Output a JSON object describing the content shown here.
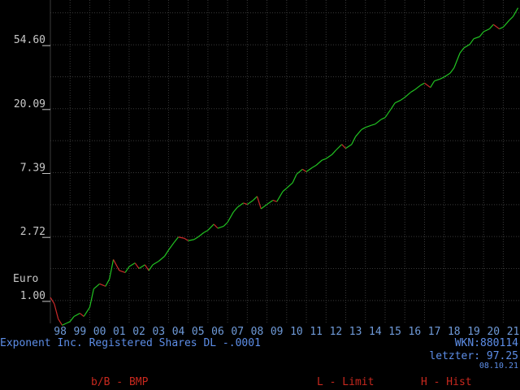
{
  "colors": {
    "background": "#000000",
    "grid": "#3a3a3a",
    "price_line": "#22c322",
    "decline_ticks": "#cc2a2a",
    "axis_text": "#c8c8c8",
    "year_labels": "#6f9ad8",
    "info_text": "#5d8ee8",
    "hotkey_text": "#c8281e"
  },
  "footer": {
    "security_name": "Exponent Inc. Registered Shares DL -.0001",
    "wkn": "WKN:880114",
    "last_price": "letzter: 97.25",
    "last_date": "08.10.21",
    "hotkeys": [
      "b/B - BMP",
      "L - Limit",
      "H - Hist"
    ]
  },
  "chart_data": {
    "type": "line",
    "title": "",
    "xlabel": "",
    "ylabel": "Euro",
    "y_scale": "log",
    "grid": true,
    "x_tick_labels": [
      "98",
      "99",
      "00",
      "01",
      "02",
      "03",
      "04",
      "05",
      "06",
      "07",
      "08",
      "09",
      "10",
      "11",
      "12",
      "13",
      "14",
      "15",
      "16",
      "17",
      "18",
      "19",
      "20",
      "21"
    ],
    "y_tick_labels": [
      "1.00",
      "2.72",
      "7.39",
      "20.09",
      "54.60"
    ],
    "y_tick_values": [
      1.0,
      2.72,
      7.39,
      20.09,
      54.6
    ],
    "ylim": [
      0.7,
      110
    ],
    "xlim": [
      1998.0,
      2021.85
    ],
    "series": [
      {
        "x": [
          1998.0,
          1998.2,
          1998.4,
          1998.6,
          1998.8,
          1999.0,
          1999.2,
          1999.5,
          1999.7,
          2000.0,
          2000.2,
          2000.5,
          2000.8,
          2001.0,
          2001.2,
          2001.5,
          2001.8,
          2002.0,
          2002.3,
          2002.5,
          2002.8,
          2003.0,
          2003.2,
          2003.5,
          2003.8,
          2004.0,
          2004.3,
          2004.5,
          2004.8,
          2005.0,
          2005.3,
          2005.5,
          2005.8,
          2006.0,
          2006.3,
          2006.5,
          2006.8,
          2007.0,
          2007.3,
          2007.5,
          2007.8,
          2008.0,
          2008.3,
          2008.5,
          2008.7,
          2009.0,
          2009.3,
          2009.5,
          2009.8,
          2010.0,
          2010.3,
          2010.5,
          2010.8,
          2011.0,
          2011.3,
          2011.5,
          2011.8,
          2012.0,
          2012.3,
          2012.5,
          2012.8,
          2013.0,
          2013.3,
          2013.5,
          2013.8,
          2014.0,
          2014.3,
          2014.5,
          2014.8,
          2015.0,
          2015.3,
          2015.5,
          2015.8,
          2016.0,
          2016.3,
          2016.5,
          2016.8,
          2017.0,
          2017.3,
          2017.5,
          2017.8,
          2018.0,
          2018.3,
          2018.5,
          2018.8,
          2019.0,
          2019.3,
          2019.5,
          2019.8,
          2020.0,
          2020.3,
          2020.5,
          2020.8,
          2021.0,
          2021.3,
          2021.5,
          2021.75
        ],
        "y": [
          1.05,
          0.95,
          0.75,
          0.68,
          0.7,
          0.72,
          0.78,
          0.82,
          0.78,
          0.9,
          1.2,
          1.3,
          1.25,
          1.4,
          1.9,
          1.6,
          1.55,
          1.7,
          1.8,
          1.65,
          1.75,
          1.6,
          1.75,
          1.85,
          2.0,
          2.2,
          2.5,
          2.7,
          2.65,
          2.55,
          2.6,
          2.7,
          2.9,
          3.0,
          3.3,
          3.1,
          3.2,
          3.4,
          4.0,
          4.3,
          4.6,
          4.5,
          4.8,
          5.1,
          4.2,
          4.5,
          4.8,
          4.7,
          5.5,
          5.8,
          6.3,
          7.2,
          7.8,
          7.5,
          8.0,
          8.3,
          9.0,
          9.2,
          9.8,
          10.5,
          11.5,
          10.8,
          11.5,
          13.0,
          14.5,
          15.0,
          15.5,
          15.8,
          17.0,
          17.5,
          20.0,
          22.0,
          23.0,
          24.0,
          26.0,
          27.0,
          29.0,
          30.0,
          28.0,
          31.0,
          32.0,
          33.0,
          35.0,
          38.0,
          48.0,
          52.0,
          55.0,
          60.0,
          62.0,
          67.0,
          70.0,
          75.0,
          70.0,
          72.0,
          80.0,
          85.0,
          97.25
        ]
      }
    ]
  }
}
